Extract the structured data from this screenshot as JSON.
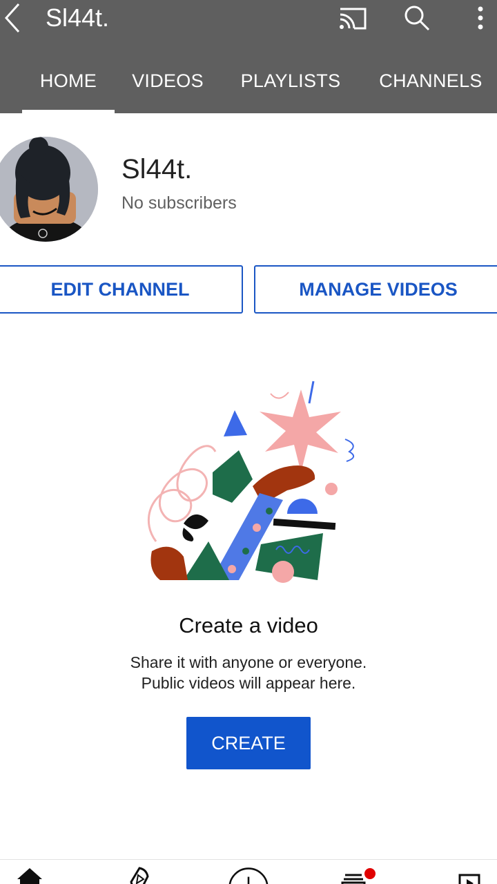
{
  "header": {
    "title": "Sl44t.",
    "back_icon": "back-arrow-icon",
    "cast_icon": "cast-icon",
    "search_icon": "search-icon",
    "more_icon": "more-vert-icon",
    "background_color": "#5f5f5f"
  },
  "tabs": [
    {
      "label": "HOME",
      "active": true
    },
    {
      "label": "VIDEOS",
      "active": false
    },
    {
      "label": "PLAYLISTS",
      "active": false
    },
    {
      "label": "CHANNELS",
      "active": false
    }
  ],
  "channel": {
    "name": "Sl44t.",
    "subscribers": "No subscribers"
  },
  "actions": {
    "edit_label": "EDIT CHANNEL",
    "manage_label": "MANAGE VIDEOS",
    "accent_color": "#1a56c4"
  },
  "empty_state": {
    "title": "Create a video",
    "description_line1": "Share it with anyone or everyone.",
    "description_line2": "Public videos will appear here.",
    "button_label": "CREATE",
    "button_color": "#1155cc"
  },
  "bottom_nav": {
    "items": [
      "home-icon",
      "explore-icon",
      "add-icon",
      "subscriptions-icon",
      "library-icon"
    ],
    "notification_dot_color": "#e00000"
  }
}
